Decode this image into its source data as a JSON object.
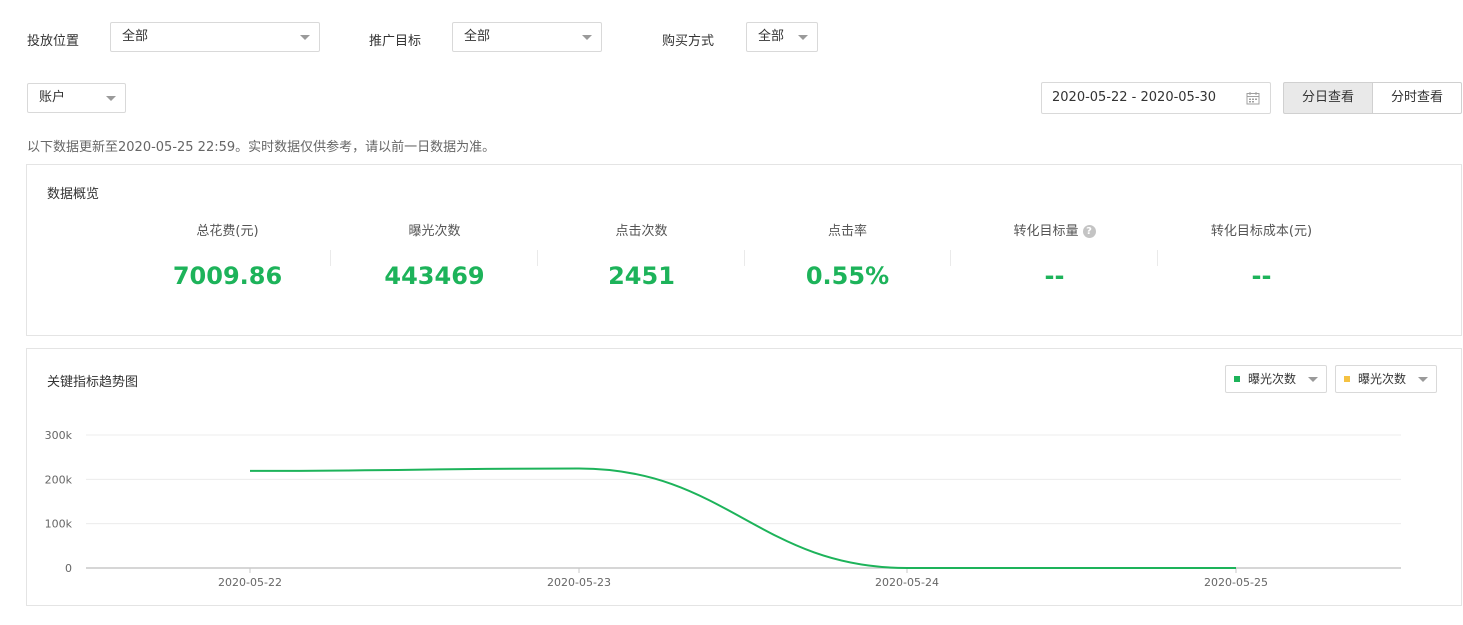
{
  "filters": {
    "placement": {
      "label": "投放位置",
      "value": "全部"
    },
    "goal": {
      "label": "推广目标",
      "value": "全部"
    },
    "purchase": {
      "label": "购买方式",
      "value": "全部"
    },
    "level": {
      "value": "账户"
    }
  },
  "date_range": "2020-05-22 - 2020-05-30",
  "view_toggle": {
    "daily": "分日查看",
    "hourly": "分时查看",
    "active": "daily"
  },
  "notice": "以下数据更新至2020-05-25 22:59。实时数据仅供参考，请以前一日数据为准。",
  "overview": {
    "title": "数据概览",
    "metrics": [
      {
        "label": "总花费(元)",
        "value": "7009.86"
      },
      {
        "label": "曝光次数",
        "value": "443469"
      },
      {
        "label": "点击次数",
        "value": "2451"
      },
      {
        "label": "点击率",
        "value": "0.55%"
      },
      {
        "label": "转化目标量",
        "value": "--",
        "help": "?"
      },
      {
        "label": "转化目标成本(元)",
        "value": "--"
      }
    ]
  },
  "trend": {
    "title": "关键指标趋势图",
    "legend": [
      {
        "label": "曝光次数",
        "color": "#1db35a"
      },
      {
        "label": "曝光次数",
        "color": "#f5c242"
      }
    ]
  },
  "colors": {
    "accent_green": "#1db35a",
    "secondary_yellow": "#f5c242"
  },
  "chart_data": {
    "type": "line",
    "title": "关键指标趋势图",
    "x": [
      "2020-05-22",
      "2020-05-23",
      "2020-05-24",
      "2020-05-25"
    ],
    "series": [
      {
        "name": "曝光次数",
        "values": [
          219000,
          224500,
          0,
          0
        ]
      }
    ],
    "y_ticks": [
      "0",
      "100k",
      "200k",
      "300k"
    ],
    "ylim": [
      0,
      300000
    ],
    "grid": true,
    "legend_position": "top-right"
  }
}
